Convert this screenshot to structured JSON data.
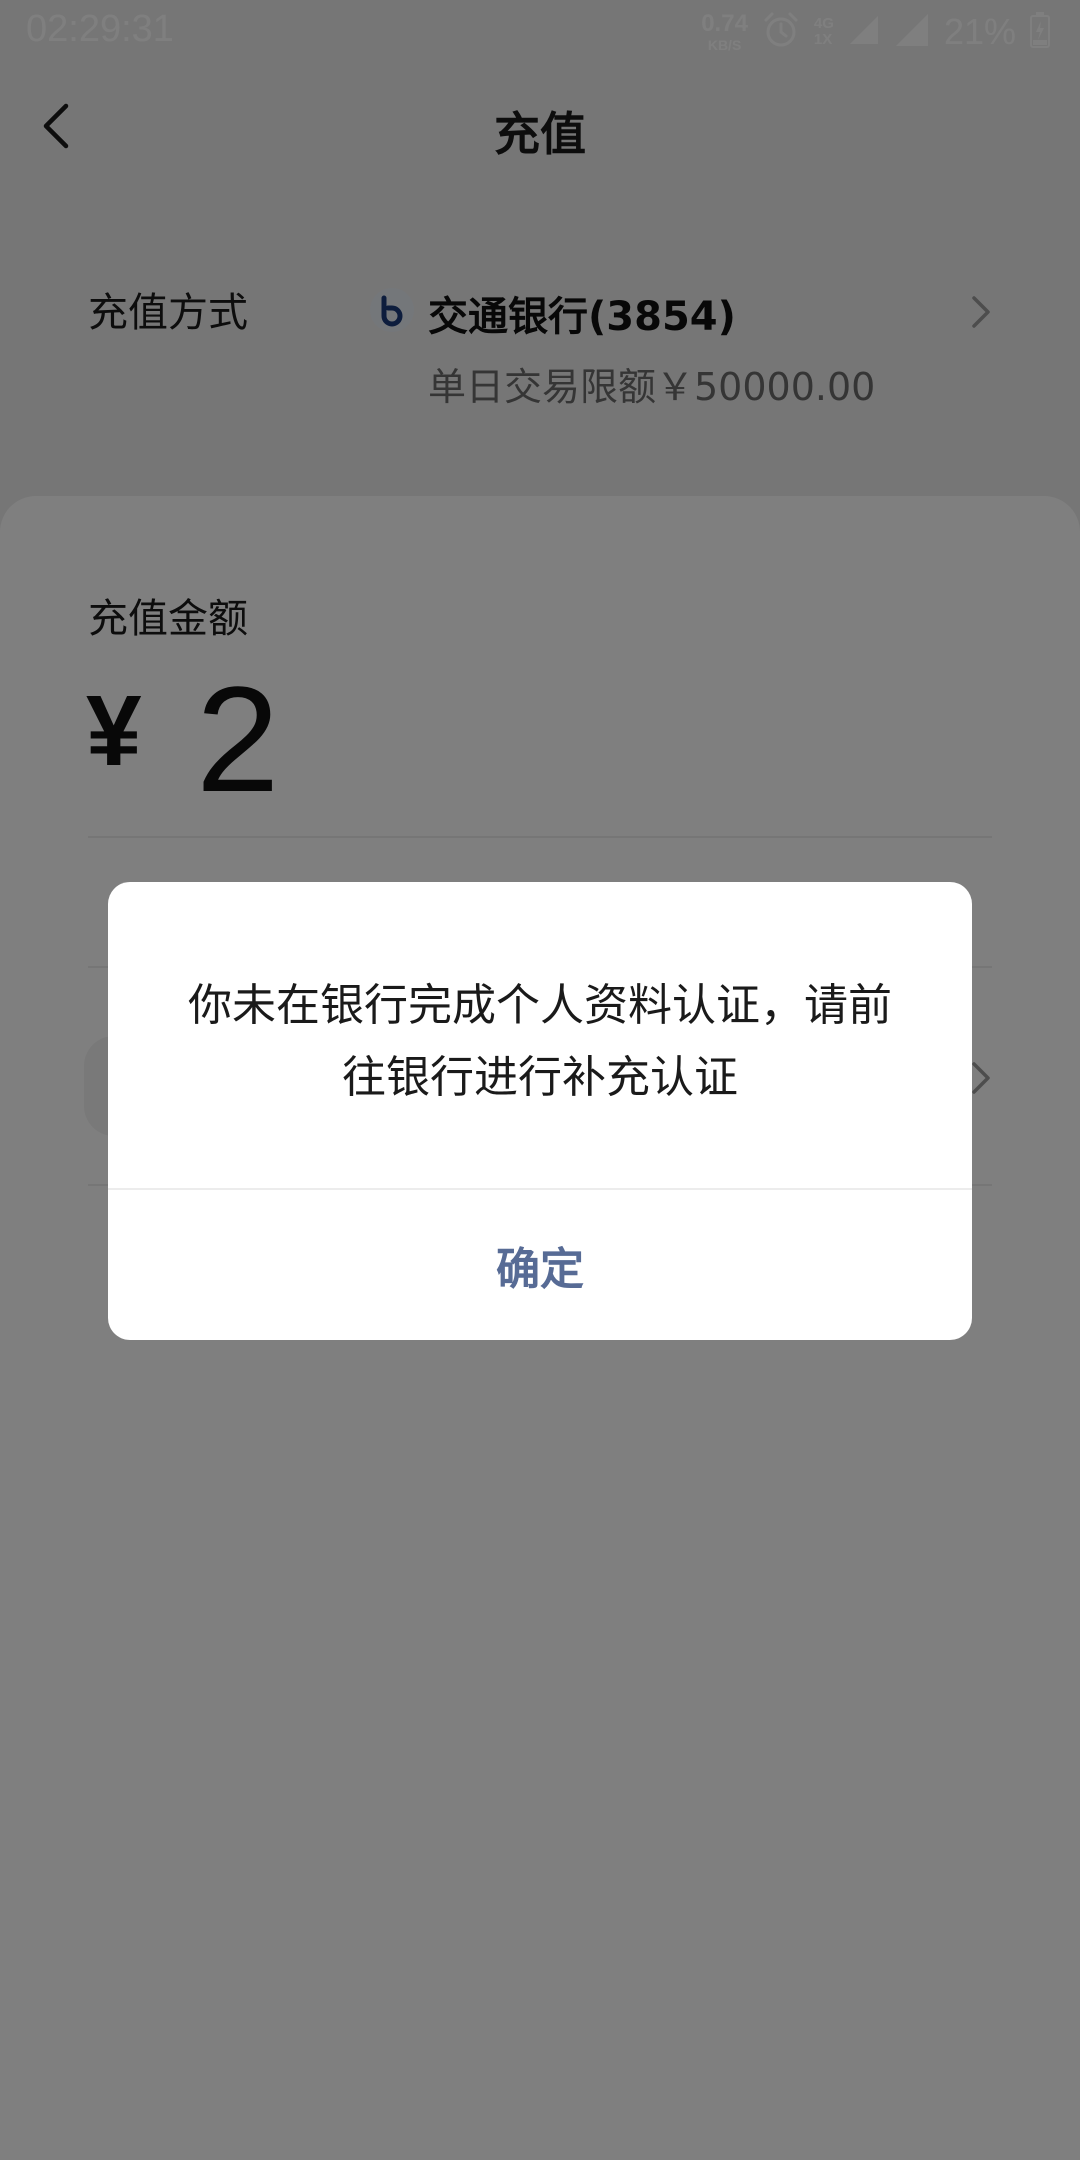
{
  "status_bar": {
    "time": "02:29:31",
    "net_speed_value": "0.74",
    "net_speed_unit": "KB/S",
    "network_top": "4G",
    "network_bottom": "1X",
    "battery": "21%"
  },
  "header": {
    "title": "充值"
  },
  "payment_method": {
    "label": "充值方式",
    "bank_name": "交通银行(3854)",
    "daily_limit": "单日交易限额￥50000.00"
  },
  "amount": {
    "label": "充值金额",
    "currency": "¥",
    "value": "2"
  },
  "dialog": {
    "message": "你未在银行完成个人资料认证，请前往银行进行补充认证",
    "confirm_label": "确定"
  },
  "colors": {
    "accent": "#576b95",
    "overlay": "rgba(0,0,0,0.5)",
    "bank_logo": "#1b3a7a"
  },
  "icons": {
    "back": "chevron-left-icon",
    "row_arrow": "chevron-right-icon",
    "alarm": "alarm-icon",
    "signal": "signal-icon",
    "battery": "battery-charging-icon"
  }
}
